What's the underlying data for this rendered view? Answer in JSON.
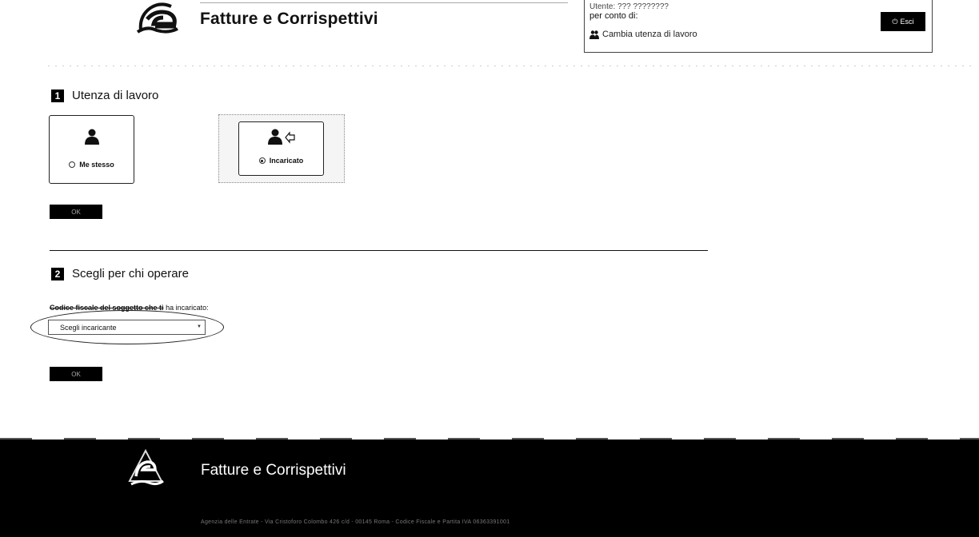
{
  "header": {
    "app_title": "Fatture e Corrispettivi",
    "user_line": "Utente: ??? ????????",
    "per_conto_label": "per conto di:",
    "cambia_link": "Cambia utenza di lavoro",
    "esci_label": "Esci"
  },
  "step1": {
    "number": "1",
    "title": "Utenza di lavoro",
    "options": [
      {
        "label": "Me stesso",
        "checked": false
      },
      {
        "label": "Incaricato",
        "checked": true
      }
    ],
    "ok_label": "OK"
  },
  "step2": {
    "number": "2",
    "title": "Scegli per chi operare",
    "field_label_struck": "Codice fiscale del soggetto che ti",
    "field_label_rest": "ha incaricato:",
    "select_value": "Scegli incaricante",
    "ok_label": "OK"
  },
  "footer": {
    "title": "Fatture e Corrispettivi",
    "note": "Agenzia delle Entrate - Via Cristoforo Colombo 426 c/d - 00145 Roma - Codice Fiscale e Partita IVA 06363391001"
  },
  "colors": {
    "accent": "#000000",
    "footer_bg": "#000000",
    "text": "#111111"
  }
}
